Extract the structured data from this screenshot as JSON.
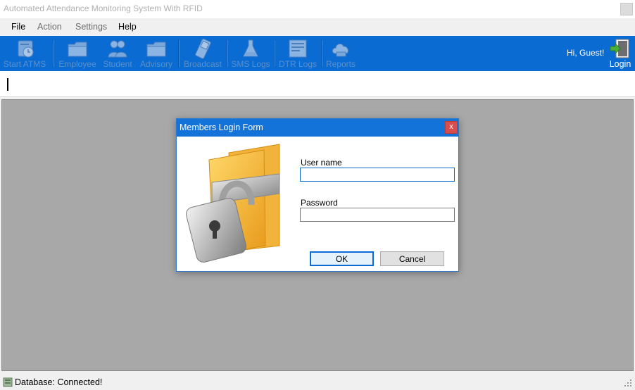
{
  "window": {
    "title": "Automated Attendance Monitoring System With RFID"
  },
  "menu": [
    {
      "label": "File",
      "enabled": true
    },
    {
      "label": "Action",
      "enabled": false
    },
    {
      "label": "Settings",
      "enabled": false
    },
    {
      "label": "Help",
      "enabled": true
    }
  ],
  "toolbar": {
    "buttons": [
      {
        "label": "Start ATMS",
        "icon": "clock-icon"
      },
      {
        "label": "Employee",
        "icon": "folder-icon"
      },
      {
        "label": "Student",
        "icon": "users-icon"
      },
      {
        "label": "Advisory",
        "icon": "folder-icon"
      },
      {
        "label": "Broadcast",
        "icon": "phone-icon"
      },
      {
        "label": "SMS Logs",
        "icon": "flask-icon"
      },
      {
        "label": "DTR Logs",
        "icon": "document-icon"
      },
      {
        "label": "Reports",
        "icon": "cloud-icon"
      }
    ],
    "greeting": "Hi, Guest!",
    "login_label": "Login",
    "colors": {
      "background": "#0a6bd3",
      "disabled_text": "#5b8fc9"
    }
  },
  "rfid_input": {
    "value": ""
  },
  "dialog": {
    "title": "Members Login Form",
    "close_glyph": "x",
    "username_label": "User name",
    "username_value": "",
    "password_label": "Password",
    "password_value": "",
    "ok_label": "OK",
    "cancel_label": "Cancel"
  },
  "status": {
    "text": "Database: Connected!"
  }
}
